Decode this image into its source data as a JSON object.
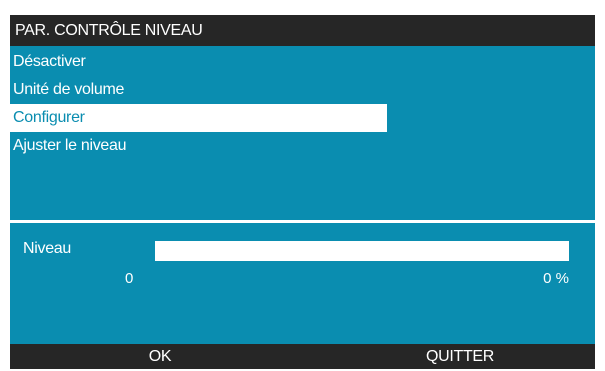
{
  "title": "PAR. CONTRÔLE NIVEAU",
  "menu": {
    "items": [
      {
        "label": "Désactiver",
        "selected": false
      },
      {
        "label": "Unité de volume",
        "selected": false
      },
      {
        "label": "Configurer",
        "selected": true
      },
      {
        "label": "Ajuster le niveau",
        "selected": false
      }
    ]
  },
  "level": {
    "label": "Niveau",
    "min_label": "0",
    "percent_label": "0 %",
    "value_fraction": 0
  },
  "softkeys": {
    "ok": "OK",
    "quit": "QUITTER"
  },
  "colors": {
    "background": "#0a8db0",
    "bar_dark": "#262626",
    "highlight": "#ffffff"
  }
}
